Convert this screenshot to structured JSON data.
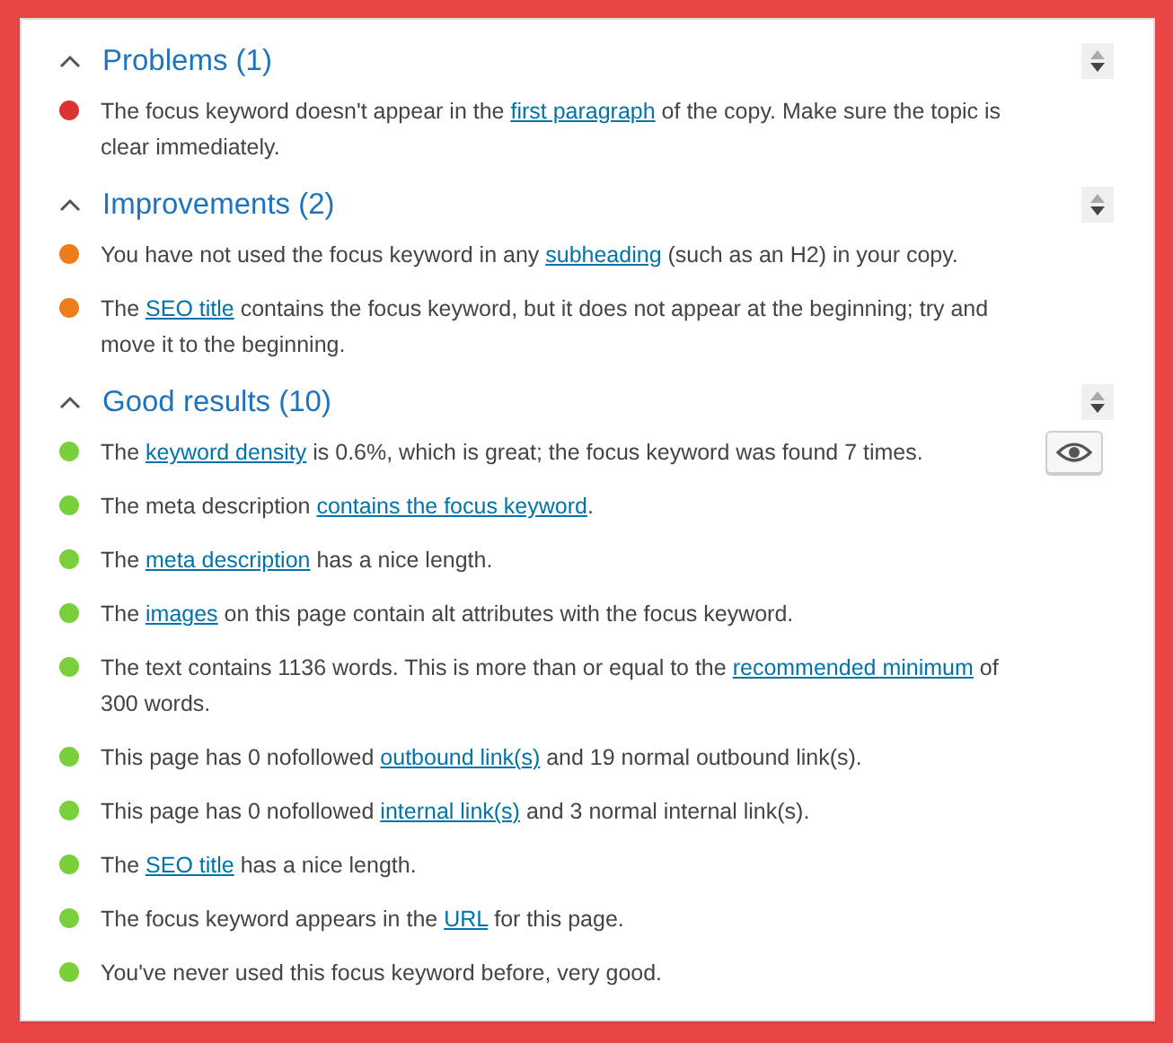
{
  "sections": [
    {
      "title": "Problems (1)",
      "expanded": true,
      "items": [
        {
          "color": "#dc3232",
          "before": "The focus keyword doesn't appear in the ",
          "link": "first paragraph",
          "after": " of the copy. Make sure the topic is clear immediately.",
          "eye_button": false
        }
      ]
    },
    {
      "title": "Improvements (2)",
      "expanded": true,
      "items": [
        {
          "color": "#ee7c1b",
          "before": "You have not used the focus keyword in any ",
          "link": "subheading",
          "after": " (such as an H2) in your copy.",
          "eye_button": false
        },
        {
          "color": "#ee7c1b",
          "before": "The ",
          "link": "SEO title",
          "after": " contains the focus keyword, but it does not appear at the beginning; try and move it to the beginning.",
          "eye_button": false
        }
      ]
    },
    {
      "title": "Good results (10)",
      "expanded": true,
      "items": [
        {
          "color": "#7ad03a",
          "before": "The ",
          "link": "keyword density",
          "after": " is 0.6%, which is great; the focus keyword was found 7 times.",
          "eye_button": true
        },
        {
          "color": "#7ad03a",
          "before": "The meta description ",
          "link": "contains the focus keyword",
          "after": ".",
          "eye_button": false
        },
        {
          "color": "#7ad03a",
          "before": "The ",
          "link": "meta description",
          "after": " has a nice length.",
          "eye_button": false
        },
        {
          "color": "#7ad03a",
          "before": "The ",
          "link": "images",
          "after": " on this page contain alt attributes with the focus keyword.",
          "eye_button": false
        },
        {
          "color": "#7ad03a",
          "before": "The text contains 1136 words. This is more than or equal to the ",
          "link": "recommended minimum",
          "after": " of 300 words.",
          "eye_button": false
        },
        {
          "color": "#7ad03a",
          "before": "This page has 0 nofollowed ",
          "link": "outbound link(s)",
          "after": " and 19 normal outbound link(s).",
          "eye_button": false
        },
        {
          "color": "#7ad03a",
          "before": "This page has 0 nofollowed ",
          "link": "internal link(s)",
          "after": " and 3 normal internal link(s).",
          "eye_button": false
        },
        {
          "color": "#7ad03a",
          "before": "The ",
          "link": "SEO title",
          "after": " has a nice length.",
          "eye_button": false
        },
        {
          "color": "#7ad03a",
          "before": "The focus keyword appears in the ",
          "link": "URL",
          "after": " for this page.",
          "eye_button": false
        },
        {
          "color": "#7ad03a",
          "before": "You've never used this focus keyword before, very good.",
          "eye_button": false
        }
      ]
    }
  ]
}
